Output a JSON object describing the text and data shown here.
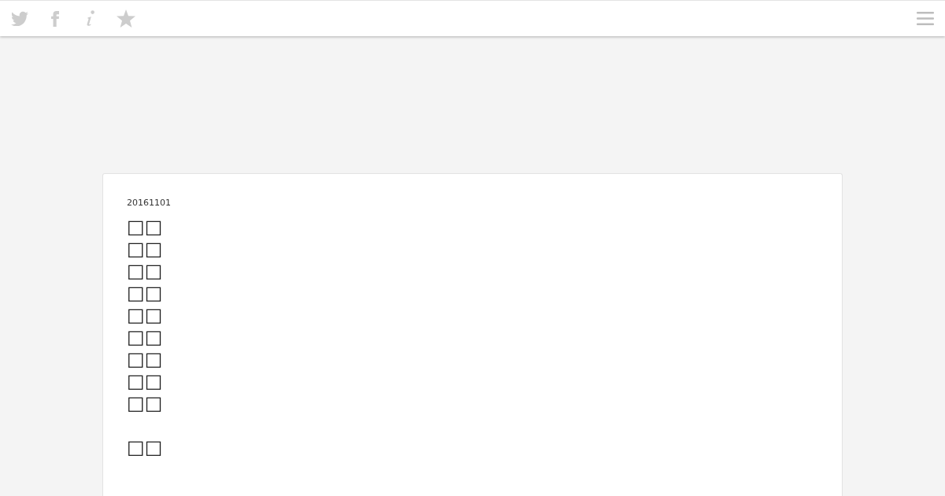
{
  "post": {
    "date": "20161101",
    "stanzas": [
      [
        "□□",
        "□□",
        "□□",
        "□□",
        "□□",
        "□□",
        "□□",
        "□□",
        "□□"
      ],
      [
        "□□"
      ]
    ]
  }
}
